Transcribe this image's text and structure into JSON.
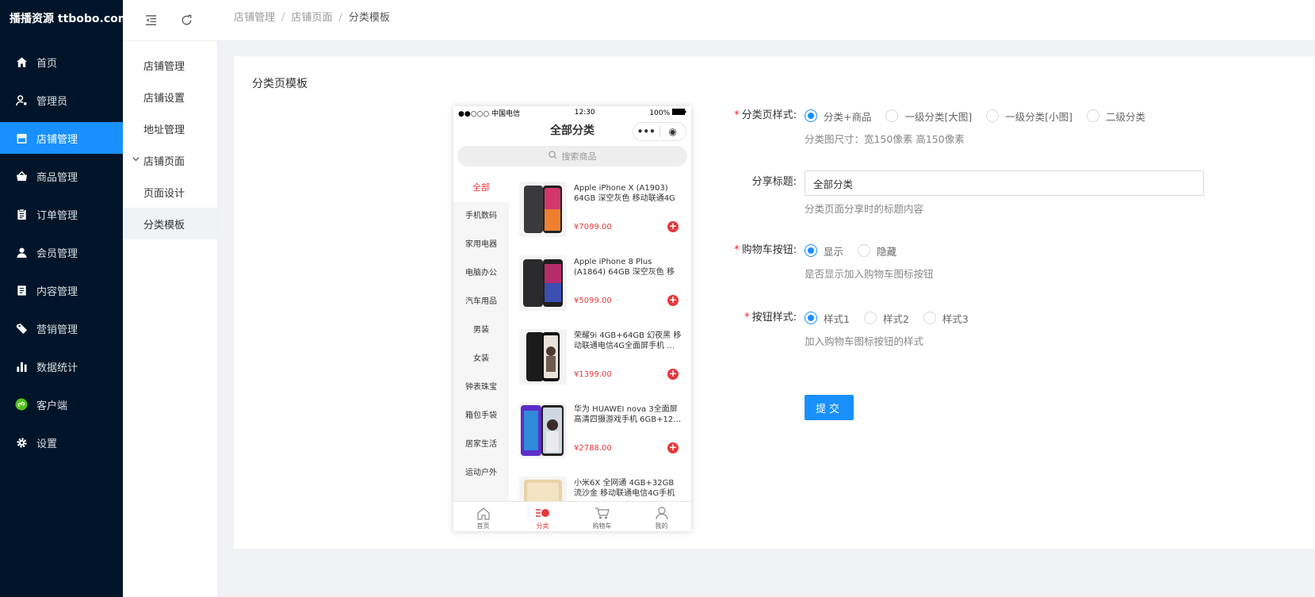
{
  "app": {
    "logo": "播播资源 ttbobo.com"
  },
  "nav": {
    "items": [
      {
        "label": "首页"
      },
      {
        "label": "管理员"
      },
      {
        "label": "店铺管理"
      },
      {
        "label": "商品管理"
      },
      {
        "label": "订单管理"
      },
      {
        "label": "会员管理"
      },
      {
        "label": "内容管理"
      },
      {
        "label": "营销管理"
      },
      {
        "label": "数据统计"
      },
      {
        "label": "客户端"
      },
      {
        "label": "设置"
      }
    ]
  },
  "subnav": {
    "items": [
      {
        "label": "店铺管理"
      },
      {
        "label": "店铺设置"
      },
      {
        "label": "地址管理"
      },
      {
        "label": "店铺页面"
      },
      {
        "label": "页面设计"
      },
      {
        "label": "分类模板"
      }
    ]
  },
  "breadcrumb": [
    "店铺管理",
    "店铺页面",
    "分类模板"
  ],
  "breadcrumb_sep": "/",
  "card": {
    "title": "分类页模板"
  },
  "phone": {
    "carrier": "●●○○○ 中国电信",
    "time": "12:30",
    "battery": "100%",
    "title": "全部分类",
    "capsule_more": "•••",
    "capsule_target": "◉",
    "search_placeholder": "搜索商品",
    "categories": [
      "全部",
      "手机数码",
      "家用电器",
      "电脑办公",
      "汽车用品",
      "男装",
      "女装",
      "钟表珠宝",
      "箱包手袋",
      "居家生活",
      "运动户外"
    ],
    "goods": [
      {
        "name": "Apple iPhone X (A1903) 64GB 深空灰色 移动联通4G手机",
        "price": "¥7099.00"
      },
      {
        "name": "Apple iPhone 8 Plus (A1864) 64GB 深空灰色 移动联通电…",
        "price": "¥5099.00"
      },
      {
        "name": "荣耀9i 4GB+64GB 幻夜黑 移动联通电信4G全面屏手机 …",
        "price": "¥1399.00"
      },
      {
        "name": "华为 HUAWEI nova 3全面屏高清四摄游戏手机 6GB+12…",
        "price": "¥2788.00"
      },
      {
        "name": "小米6X 全网通 4GB+32GB 流沙金 移动联通电信4G手机",
        "price": ""
      }
    ],
    "add_symbol": "+",
    "tabs": [
      {
        "label": "首页"
      },
      {
        "label": "分类"
      },
      {
        "label": "购物车"
      },
      {
        "label": "我的"
      }
    ]
  },
  "form": {
    "style": {
      "label": "分类页样式",
      "required": "*",
      "options": [
        "分类+商品",
        "一级分类[大图]",
        "一级分类[小图]",
        "二级分类"
      ],
      "selected": 0,
      "help": "分类图尺寸：宽150像素 高150像素"
    },
    "share": {
      "label": "分享标题",
      "value": "全部分类",
      "help": "分类页面分享时的标题内容"
    },
    "cart": {
      "label": "购物车按钮",
      "required": "*",
      "options": [
        "显示",
        "隐藏"
      ],
      "selected": 0,
      "help": "是否显示加入购物车图标按钮"
    },
    "btnstyle": {
      "label": "按钮样式",
      "required": "*",
      "options": [
        "样式1",
        "样式2",
        "样式3"
      ],
      "selected": 0,
      "help": "加入购物车图标按钮的样式"
    },
    "submit_label": "提交",
    "colon": ":"
  },
  "colors": {
    "primary": "#1890ff",
    "sidebar": "#001529",
    "accent_red": "#e4393c"
  }
}
